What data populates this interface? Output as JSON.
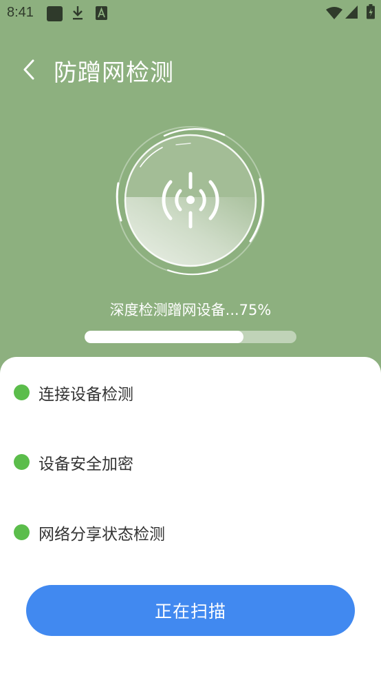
{
  "status_bar": {
    "time": "8:41",
    "icons": [
      "app-square-icon",
      "download-icon",
      "font-a-icon",
      "wifi-icon",
      "signal-icon",
      "battery-icon"
    ]
  },
  "header": {
    "back_icon": "chevron-left-icon",
    "title": "防蹭网检测"
  },
  "scan": {
    "text": "深度检测蹭网设备...75%",
    "progress_percent": 75
  },
  "checklist": [
    {
      "label": "连接设备检测",
      "status_color": "#5bbd4b"
    },
    {
      "label": "设备安全加密",
      "status_color": "#5bbd4b"
    },
    {
      "label": "网络分享状态检测",
      "status_color": "#5bbd4b"
    }
  ],
  "action_button": {
    "label": "正在扫描",
    "color": "#4189f0"
  },
  "colors": {
    "header_bg": "#8db07f",
    "panel_bg": "#ffffff"
  }
}
